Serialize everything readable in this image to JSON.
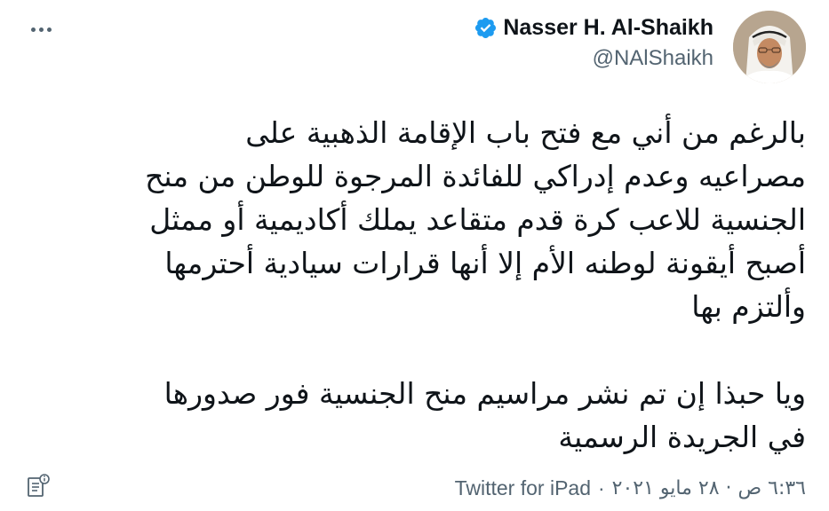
{
  "author": {
    "name": "Nasser H. Al-Shaikh",
    "handle": "@NAlShaikh",
    "verified": true,
    "verified_color": "#1d9bf0"
  },
  "tweet": {
    "paragraph1": [
      "بالرغم من أني مع فتح باب الإقامة الذهبية على",
      "مصراعيه وعدم إدراكي للفائدة المرجوة للوطن من منح",
      "الجنسية للاعب كرة قدم متقاعد يملك أكاديمية أو ممثل",
      "أصبح أيقونة لوطنه الأم إلا أنها قرارات سيادية أحترمها",
      "وألتزم بها"
    ],
    "paragraph2": [
      "ويا حبذا إن تم نشر مراسيم منح الجنسية فور صدورها",
      "في الجريدة الرسمية"
    ]
  },
  "meta": {
    "time": "٦:٣٦ ص · ٢٨ مايو ٢٠٢١",
    "separator": "·",
    "source": "Twitter for iPad"
  },
  "icons": {
    "more": "more-options-icon",
    "info": "tweet-info-icon",
    "verified": "verified-badge-icon"
  },
  "colors": {
    "text": "#0f1419",
    "secondary": "#536471",
    "accent": "#1d9bf0"
  }
}
